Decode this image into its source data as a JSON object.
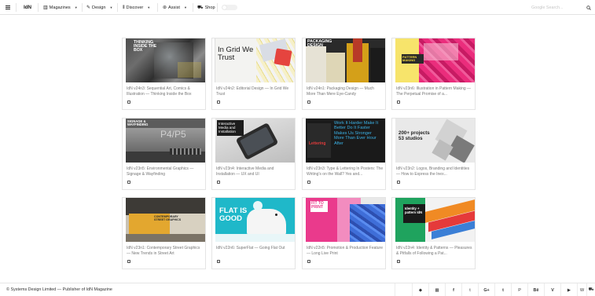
{
  "nav": {
    "logo": "IdN",
    "items": [
      {
        "label": "Magazines",
        "icon": "book-icon",
        "has_caret": true
      },
      {
        "label": "Design",
        "icon": "pencil-icon",
        "has_caret": true
      },
      {
        "label": "Discover",
        "icon": "columns-icon",
        "has_caret": true
      },
      {
        "label": "Assist",
        "icon": "life-ring-icon",
        "has_caret": true
      },
      {
        "label": "Shop",
        "icon": "cart-icon",
        "has_caret": false
      }
    ],
    "search_placeholder": "Google Search..."
  },
  "cards": [
    {
      "title": "IdN v24n3: Sequential Art, Comics & Illustration — Thinking Inside the Box",
      "cover_text": "THINKING INSIDE THE BOX"
    },
    {
      "title": "IdN v24n2: Editorial Design — In Grid We Trust",
      "cover_text": "In Grid We Trust"
    },
    {
      "title": "IdN v24n1: Packaging Design — Much More Than Mere Eye-Candy",
      "cover_text": "PACKAGING DESIGN"
    },
    {
      "title": "IdN v23n6: Illustration in Pattern Making — The Perpetual Promise of a...",
      "cover_text": "PATTERN MAKING"
    },
    {
      "title": "IdN v23n5: Environmental Graphics — Signage & Wayfinding",
      "cover_text": "SIGNAGE & WAYFINDING"
    },
    {
      "title": "IdN v23n4: Interactive Media and Installation — UX and UI",
      "cover_text": "Interactive Media and Installation"
    },
    {
      "title": "IdN v23n3: Type & Lettering In Posters: The Writing's on the Wall? Yes and...",
      "cover_text": "Work It Harder Make It Better Do It Faster Makes Us Stronger More Than Ever Hour After"
    },
    {
      "title": "IdN v23n2: Logos, Branding and Identities — How to Express the Inex...",
      "cover_text": "200+ projects 53 studios"
    },
    {
      "title": "IdN v23n1: Contemporary Street Graphics — New Trends in Street Art",
      "cover_text": "CONTEMPORARY STREET GRAPHICS"
    },
    {
      "title": "IdN v22n6: SuperFlat — Going Flat Out",
      "cover_text": "FLAT IS GOOD"
    },
    {
      "title": "IdN v22n5: Promotion & Production Feature — Long Live Print",
      "cover_text": "FIT TO PRINT"
    },
    {
      "title": "IdN v22n4: Identity & Patterns — Pleasures & Pitfalls of Following a Pat...",
      "cover_text": "Identity + pattern IdN"
    }
  ],
  "footer": {
    "copyright": "© Systems Design Limited — Publisher of IdN Magazine",
    "social": [
      {
        "icon": "apple-icon",
        "glyph": ""
      },
      {
        "icon": "android-icon",
        "glyph": "◆"
      },
      {
        "icon": "windows-icon",
        "glyph": "▦"
      },
      {
        "icon": "facebook-icon",
        "glyph": "f"
      },
      {
        "icon": "twitter-icon",
        "glyph": "t"
      },
      {
        "icon": "google-plus-icon",
        "glyph": "G+"
      },
      {
        "icon": "tumblr-icon",
        "glyph": "t"
      },
      {
        "icon": "pinterest-icon",
        "glyph": "P"
      },
      {
        "icon": "behance-icon",
        "glyph": "Bē"
      },
      {
        "icon": "vimeo-icon",
        "glyph": "V"
      },
      {
        "icon": "youtube-icon",
        "glyph": "▶"
      },
      {
        "icon": "weibo-icon",
        "glyph": "W"
      },
      {
        "icon": "cart-icon",
        "glyph": "⛟"
      }
    ]
  }
}
